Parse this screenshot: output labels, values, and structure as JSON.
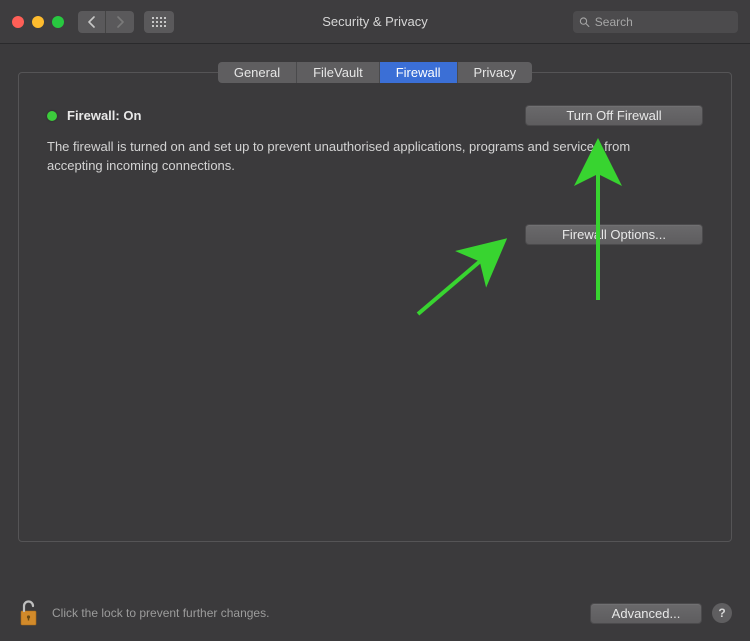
{
  "window": {
    "title": "Security & Privacy",
    "search_placeholder": "Search"
  },
  "tabs": [
    {
      "label": "General"
    },
    {
      "label": "FileVault"
    },
    {
      "label": "Firewall",
      "active": true
    },
    {
      "label": "Privacy"
    }
  ],
  "firewall": {
    "status_label": "Firewall: On",
    "status_color": "#3ccb3c",
    "turn_off_label": "Turn Off Firewall",
    "description": "The firewall is turned on and set up to prevent unauthorised applications, programs and services from accepting incoming connections.",
    "options_label": "Firewall Options..."
  },
  "footer": {
    "lock_hint": "Click the lock to prevent further changes.",
    "advanced_label": "Advanced...",
    "help_label": "?"
  },
  "annotations": {
    "arrow_color": "#38d430"
  }
}
